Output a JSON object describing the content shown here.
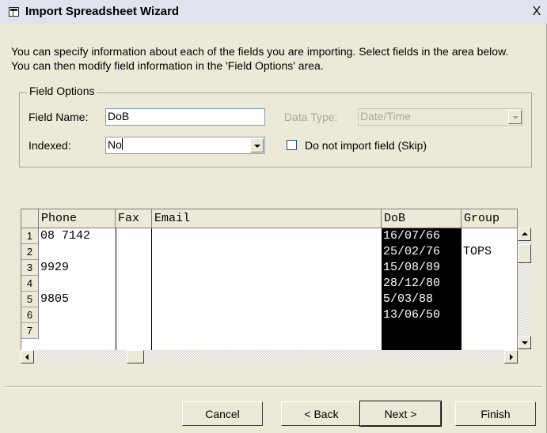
{
  "window": {
    "title": "Import Spreadsheet Wizard",
    "close_label": "X"
  },
  "intro": {
    "text": "You can specify information about each of the fields you are importing.  Select fields in the area below. You can then modify field information in the 'Field Options' area."
  },
  "field_options": {
    "legend": "Field Options",
    "field_name_label": "Field Name:",
    "field_name_value": "DoB",
    "indexed_label": "Indexed:",
    "indexed_value": "No",
    "data_type_label": "Data Type:",
    "data_type_value": "Date/Time",
    "skip_label": "Do not import field (Skip)",
    "skip_checked": false
  },
  "grid": {
    "columns": [
      "Phone",
      "Fax",
      "Email",
      "DoB",
      "Group"
    ],
    "selected_column": "DoB",
    "row_numbers": [
      "1",
      "2",
      "3",
      "4",
      "5",
      "6",
      "7"
    ],
    "rows": [
      {
        "phone": "08 7142",
        "fax": "",
        "email": "",
        "dob": "16/07/66",
        "group": ""
      },
      {
        "phone": "",
        "fax": "",
        "email": "",
        "dob": "25/02/76",
        "group": "TOPS"
      },
      {
        "phone": " 9929",
        "fax": "",
        "email": "",
        "dob": "15/08/89",
        "group": ""
      },
      {
        "phone": "",
        "fax": "",
        "email": "",
        "dob": "28/12/80",
        "group": ""
      },
      {
        "phone": " 9805",
        "fax": "",
        "email": "",
        "dob": "5/03/88",
        "group": ""
      },
      {
        "phone": "",
        "fax": "",
        "email": "",
        "dob": "13/06/50",
        "group": ""
      },
      {
        "phone": "",
        "fax": "",
        "email": "",
        "dob": "",
        "group": ""
      }
    ]
  },
  "buttons": {
    "cancel": "Cancel",
    "back": "< Back",
    "next": "Next >",
    "finish": "Finish"
  },
  "colors": {
    "dialog_bg": "#ece9d8",
    "selection": "#000000"
  }
}
